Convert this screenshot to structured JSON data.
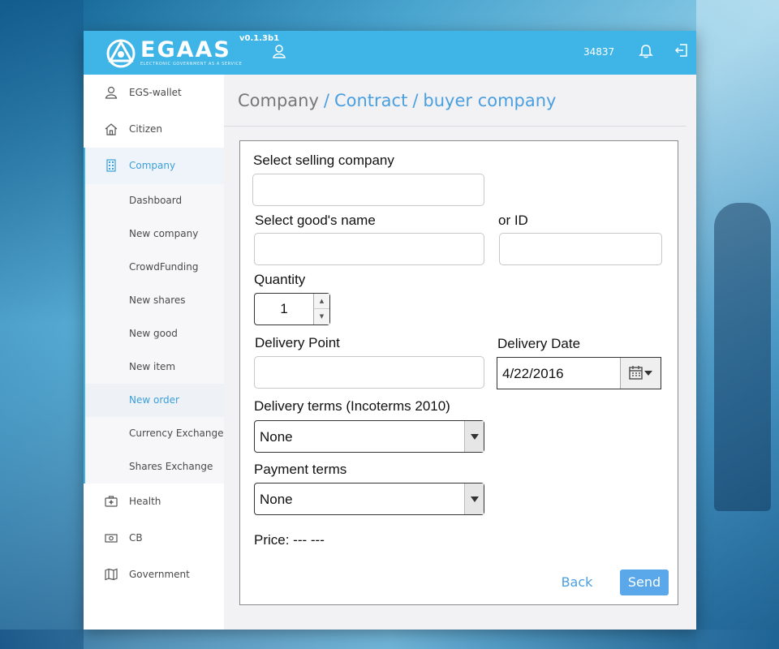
{
  "header": {
    "logo_text": "EGAAS",
    "logo_subtitle": "ELECTRONIC GOVERNMENT AS A SERVICE",
    "version": "v0.1.3b1",
    "account_number": "34837",
    "user_icon": "user-icon",
    "bell_icon": "bell-icon",
    "logout_icon": "logout-icon",
    "accent_color": "#3fb4e6"
  },
  "sidebar": {
    "items": [
      {
        "label": "EGS-wallet",
        "icon": "user-icon"
      },
      {
        "label": "Citizen",
        "icon": "home-icon"
      },
      {
        "label": "Company",
        "icon": "building-icon"
      },
      {
        "label": "Health",
        "icon": "medkit-icon"
      },
      {
        "label": "CB",
        "icon": "money-icon"
      },
      {
        "label": "Government",
        "icon": "map-icon"
      }
    ],
    "company_subitems": [
      {
        "label": "Dashboard"
      },
      {
        "label": "New company"
      },
      {
        "label": "CrowdFunding"
      },
      {
        "label": "New shares"
      },
      {
        "label": "New good"
      },
      {
        "label": "New item"
      },
      {
        "label": "New order"
      },
      {
        "label": "Currency Exchange"
      },
      {
        "label": "Shares Exchange"
      }
    ],
    "active_item": "Company",
    "selected_subitem": "New order"
  },
  "breadcrumb": {
    "parts": [
      "Company",
      "Contract",
      "buyer company"
    ],
    "separator": "/"
  },
  "form": {
    "selling_company_label": "Select selling company",
    "selling_company_value": "",
    "goods_name_label": "Select good's name",
    "goods_name_value": "",
    "or_id_label": "or ID",
    "or_id_value": "",
    "quantity_label": "Quantity",
    "quantity_value": "1",
    "delivery_point_label": "Delivery Point",
    "delivery_point_value": "",
    "delivery_date_label": "Delivery Date",
    "delivery_date_value": "4/22/2016",
    "calendar_icon": "calendar-icon",
    "delivery_terms_label": "Delivery terms (Incoterms 2010)",
    "delivery_terms_value": "None",
    "payment_terms_label": "Payment terms",
    "payment_terms_value": "None",
    "price_text": "Price: --- ---",
    "back_label": "Back",
    "send_label": "Send",
    "send_color": "#5aa8ea"
  }
}
